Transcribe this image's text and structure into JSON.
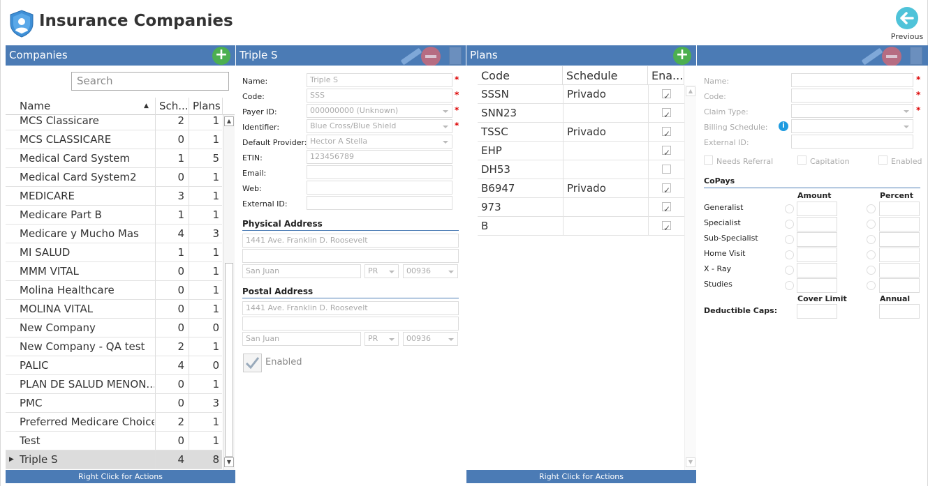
{
  "header": {
    "title": "Insurance Companies",
    "previous_label": "Previous"
  },
  "companies": {
    "panel_title": "Companies",
    "search_placeholder": "Search",
    "columns": [
      "Name",
      "Sch...",
      "Plans"
    ],
    "rows": [
      {
        "name": "MCS Classicare",
        "sch": "2",
        "plans": "1"
      },
      {
        "name": "MCS CLASSICARE",
        "sch": "0",
        "plans": "1"
      },
      {
        "name": "Medical Card System",
        "sch": "1",
        "plans": "5"
      },
      {
        "name": "Medical Card System2",
        "sch": "0",
        "plans": "1"
      },
      {
        "name": "MEDICARE",
        "sch": "3",
        "plans": "1"
      },
      {
        "name": "Medicare Part B",
        "sch": "1",
        "plans": "1"
      },
      {
        "name": "Medicare y Mucho Mas",
        "sch": "4",
        "plans": "3"
      },
      {
        "name": "MI SALUD",
        "sch": "1",
        "plans": "1"
      },
      {
        "name": "MMM VITAL",
        "sch": "0",
        "plans": "1"
      },
      {
        "name": "Molina Healthcare",
        "sch": "0",
        "plans": "1"
      },
      {
        "name": "MOLINA VITAL",
        "sch": "0",
        "plans": "1"
      },
      {
        "name": "New Company",
        "sch": "0",
        "plans": "0"
      },
      {
        "name": "New Company - QA test",
        "sch": "2",
        "plans": "1"
      },
      {
        "name": "PALIC",
        "sch": "4",
        "plans": "0"
      },
      {
        "name": "PLAN DE SALUD MENON...",
        "sch": "0",
        "plans": "1"
      },
      {
        "name": "PMC",
        "sch": "0",
        "plans": "3"
      },
      {
        "name": "Preferred Medicare Choice",
        "sch": "2",
        "plans": "1"
      },
      {
        "name": "Test",
        "sch": "0",
        "plans": "1"
      },
      {
        "name": "Triple S",
        "sch": "4",
        "plans": "8"
      }
    ],
    "footer": "Right Click for Actions"
  },
  "company_detail": {
    "panel_title": "Triple S",
    "labels": {
      "name": "Name:",
      "code": "Code:",
      "payer_id": "Payer ID:",
      "identifier": "Identifier:",
      "default_provider": "Default Provider:",
      "etin": "ETIN:",
      "email": "Email:",
      "web": "Web:",
      "external_id": "External ID:"
    },
    "values": {
      "name": "Triple S",
      "code": "SSS",
      "payer_id": "000000000 (Unknown)",
      "identifier": "Blue Cross/Blue Shield",
      "default_provider": "Hector A Stella",
      "etin": "123456789",
      "email": "",
      "web": "",
      "external_id": ""
    },
    "physical_address": {
      "title": "Physical Address",
      "line1": "1441 Ave. Franklin D. Roosevelt",
      "line2": "",
      "city": "San Juan",
      "state": "PR",
      "zip": "00936"
    },
    "postal_address": {
      "title": "Postal Address",
      "line1": "1441 Ave. Franklin D. Roosevelt",
      "line2": "",
      "city": "San Juan",
      "state": "PR",
      "zip": "00936"
    },
    "enabled_label": "Enabled",
    "enabled": true
  },
  "plans": {
    "panel_title": "Plans",
    "columns": [
      "Code",
      "Schedule",
      "Ena..."
    ],
    "rows": [
      {
        "code": "SSSN",
        "schedule": "Privado",
        "enabled": true
      },
      {
        "code": "SNN23",
        "schedule": "",
        "enabled": true
      },
      {
        "code": "TSSC",
        "schedule": "Privado",
        "enabled": true
      },
      {
        "code": "EHP",
        "schedule": "",
        "enabled": true
      },
      {
        "code": "DH53",
        "schedule": "",
        "enabled": false
      },
      {
        "code": "B6947",
        "schedule": "Privado",
        "enabled": true
      },
      {
        "code": "973",
        "schedule": "",
        "enabled": true
      },
      {
        "code": "B",
        "schedule": "",
        "enabled": true
      }
    ],
    "footer": "Right Click for Actions"
  },
  "plan_detail": {
    "labels": {
      "name": "Name:",
      "code": "Code:",
      "claim_type": "Claim Type:",
      "billing_schedule": "Billing Schedule:",
      "external_id": "External ID:"
    },
    "checkboxes": {
      "needs_referral": "Needs Referral",
      "capitation": "Capitation",
      "enabled": "Enabled"
    },
    "copays": {
      "title": "CoPays",
      "amount_header": "Amount",
      "percent_header": "Percent",
      "rows": [
        "Generalist",
        "Specialist",
        "Sub-Specialist",
        "Home Visit",
        "X - Ray",
        "Studies"
      ],
      "cover_limit_header": "Cover Limit",
      "annual_header": "Annual",
      "deductible_label": "Deductible Caps:"
    }
  },
  "colors": {
    "header_blue": "#4b7bb5",
    "add_green": "#4caf50",
    "required_red": "#dd0000",
    "previous_teal": "#4fc3d9"
  },
  "icons": {
    "logo": "shield-user-icon",
    "previous": "arrow-left-icon",
    "add": "plus-icon",
    "edit": "pencil-icon",
    "delete": "minus-icon",
    "save": "floppy-icon",
    "info": "info-icon"
  }
}
